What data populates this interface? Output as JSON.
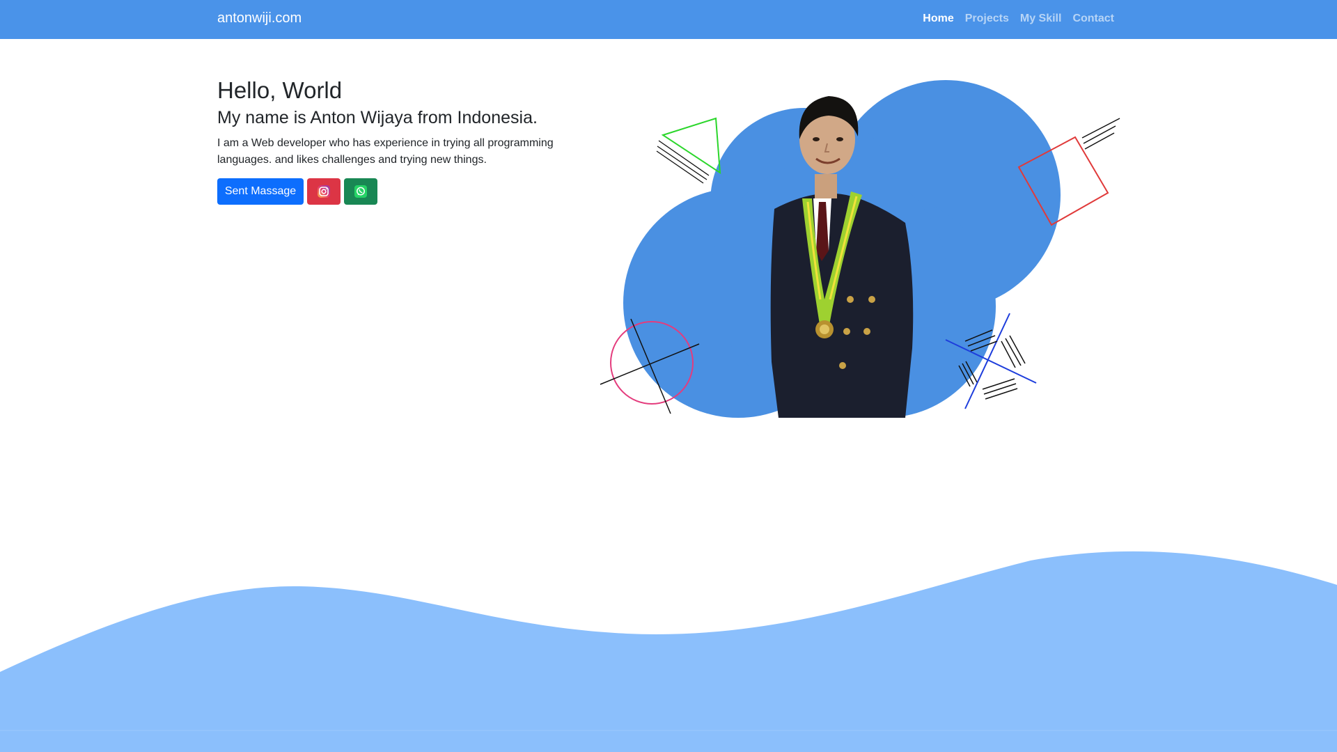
{
  "navbar": {
    "brand": "antonwiji.com",
    "links": [
      {
        "label": "Home",
        "active": true
      },
      {
        "label": "Projects",
        "active": false
      },
      {
        "label": "My Skill",
        "active": false
      },
      {
        "label": "Contact",
        "active": false
      }
    ]
  },
  "hero": {
    "title": "Hello, World",
    "subtitle": "My name is Anton Wijaya from Indonesia.",
    "description": "I am a Web developer who has experience in trying all programming languages. and likes challenges and trying new things.",
    "buttons": {
      "message_label": "Sent Massage",
      "instagram_icon": "instagram-icon",
      "whatsapp_icon": "whatsapp-icon"
    }
  },
  "colors": {
    "navbar": "#4a93e9",
    "blob": "#4a90e2",
    "wave": "#8bbffc",
    "primary": "#0d6efd",
    "instagram": "#dc3545",
    "whatsapp": "#198754"
  }
}
